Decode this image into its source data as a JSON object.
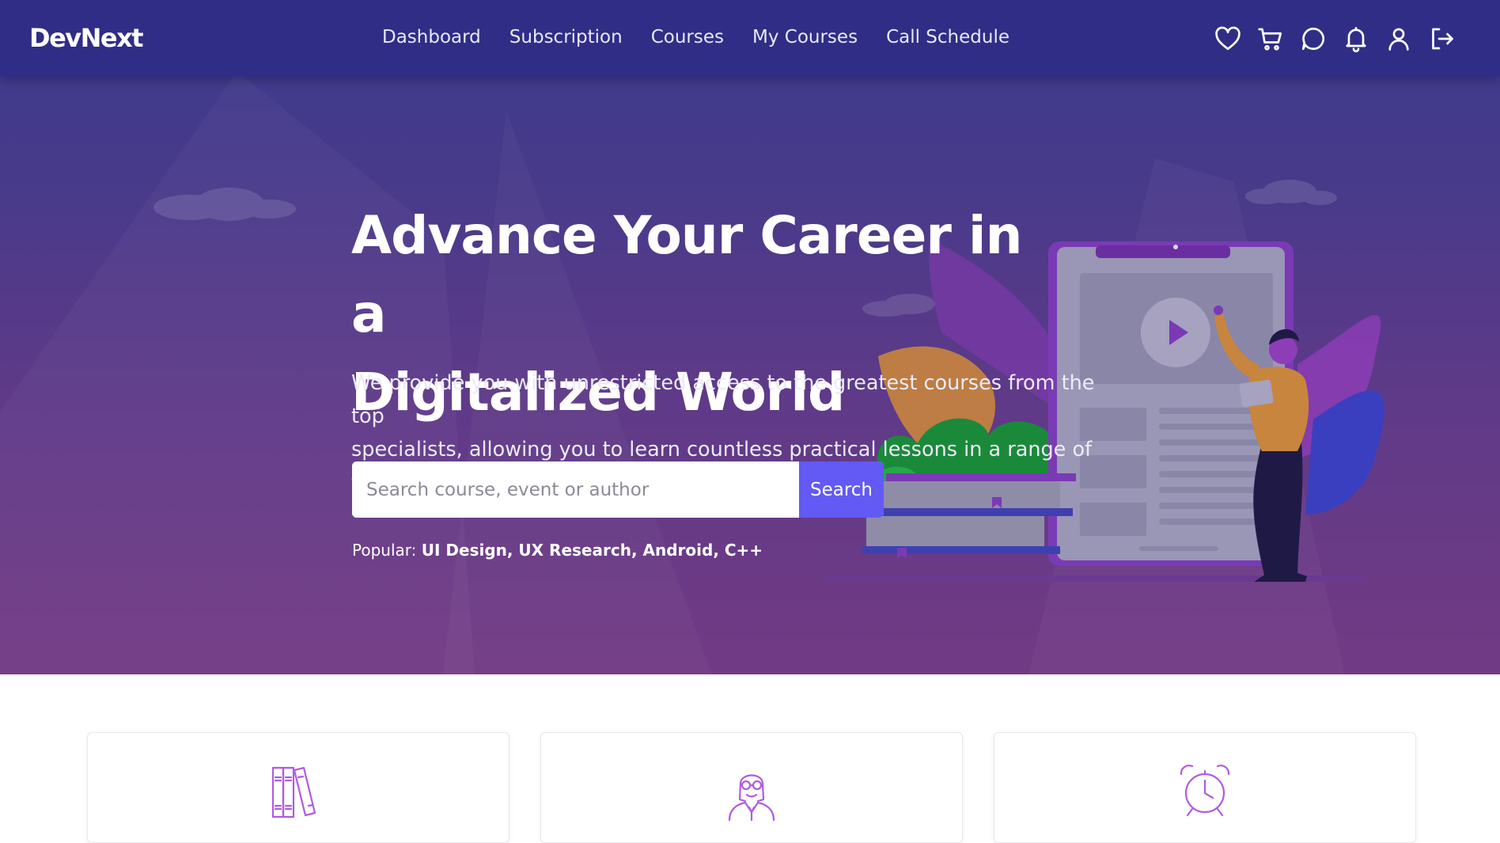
{
  "brand": {
    "logo": "DevNext"
  },
  "nav": {
    "links": [
      "Dashboard",
      "Subscription",
      "Courses",
      "My Courses",
      "Call Schedule"
    ],
    "icons": [
      "heart-icon",
      "cart-icon",
      "chat-icon",
      "bell-icon",
      "user-icon",
      "logout-icon"
    ]
  },
  "hero": {
    "title_line1": "Advance Your Career in a",
    "title_line2": "Digitalized World",
    "desc_line1": "We provide you with unrestricted access to the greatest courses from the top",
    "desc_line2": "specialists, allowing you to learn countless practical lessons in a range of topics.",
    "search": {
      "placeholder": "Search course, event or author",
      "value": "",
      "button": "Search"
    },
    "popular": {
      "label": "Popular:",
      "tags": "UI Design, UX Research, Android, C++"
    }
  },
  "cards": {
    "icons": [
      "books-icon",
      "teacher-icon",
      "alarm-clock-icon"
    ]
  },
  "colors": {
    "navbar": "#302d86",
    "hero_top": "#3a3a8c",
    "hero_bottom": "#723a84",
    "accent": "#6359f5",
    "icon_purple": "#b05be0"
  }
}
